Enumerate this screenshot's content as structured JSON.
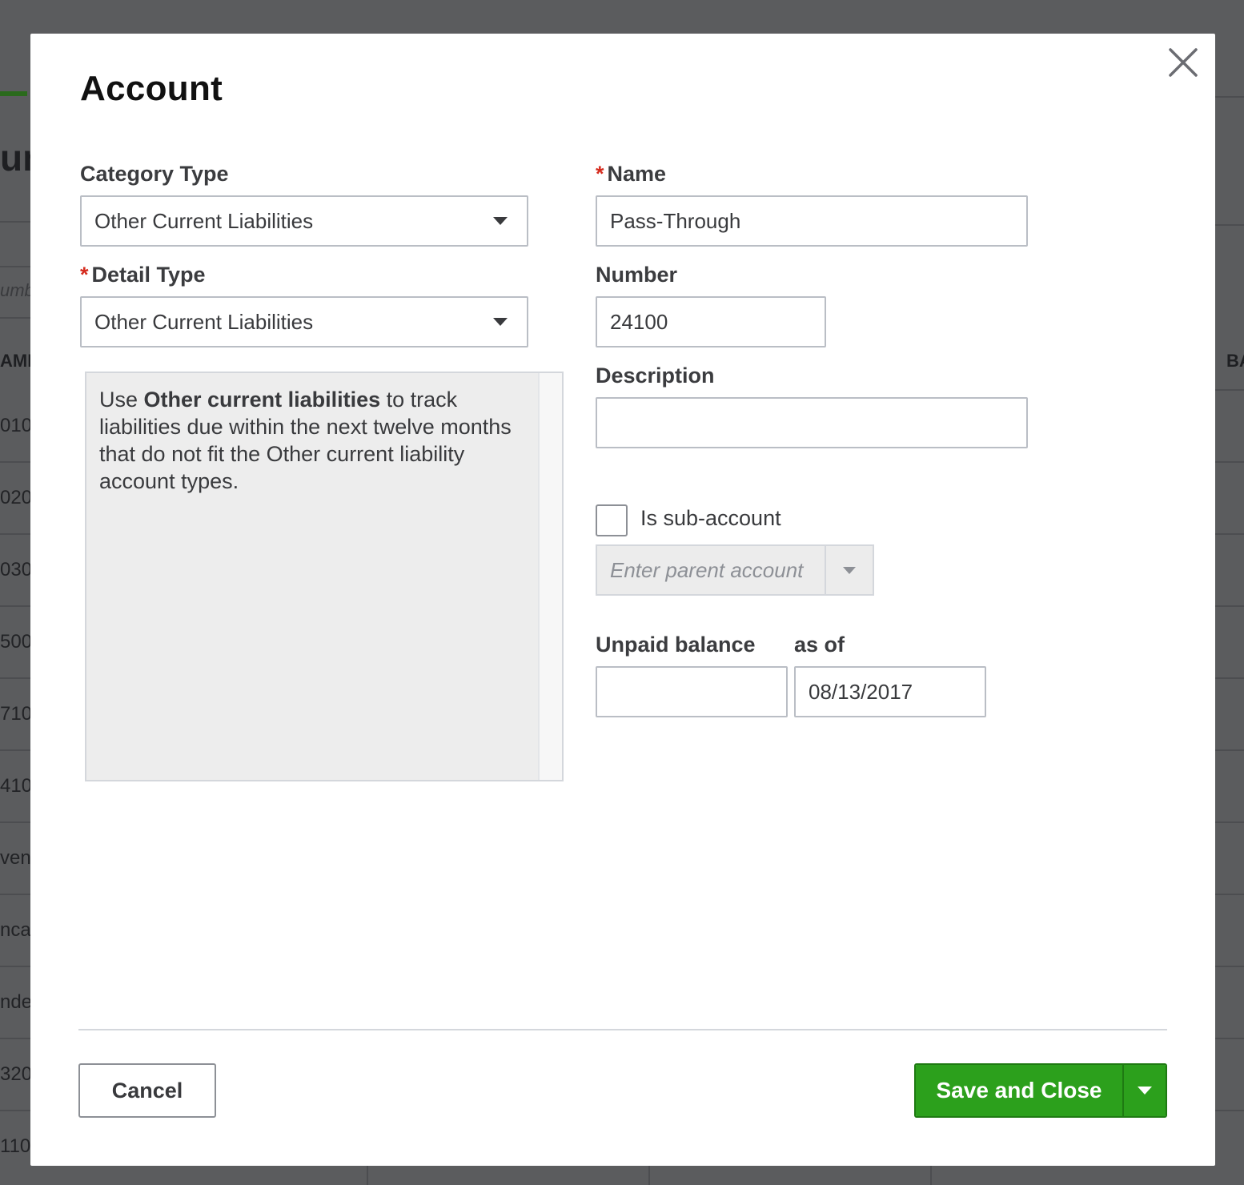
{
  "background": {
    "heading_fragment": "un",
    "search_fragment": "umb",
    "column_left_fragment": "AMI",
    "column_right_fragment": "BA",
    "row_fragments": [
      "010",
      "020",
      "030",
      "500",
      "710",
      "410",
      "ven",
      "ncat",
      "nde",
      "320",
      "110"
    ]
  },
  "modal": {
    "title": "Account",
    "close_icon": "close-icon",
    "category_type": {
      "label": "Category Type",
      "value": "Other Current Liabilities"
    },
    "detail_type": {
      "required_mark": "*",
      "label": "Detail Type",
      "value": "Other Current Liabilities"
    },
    "help": {
      "prefix": "Use ",
      "bold": "Other current liabilities",
      "suffix": " to track liabilities due within the next twelve months that do not fit the Other current liability account types."
    },
    "name": {
      "required_mark": "*",
      "label": "Name",
      "value": "Pass-Through"
    },
    "number": {
      "label": "Number",
      "value": "24100"
    },
    "description": {
      "label": "Description",
      "value": ""
    },
    "sub_account": {
      "label": "Is sub-account",
      "checked": false
    },
    "parent_account": {
      "placeholder": "Enter parent account"
    },
    "unpaid_balance": {
      "label": "Unpaid balance",
      "value": ""
    },
    "as_of": {
      "label": "as of",
      "value": "08/13/2017"
    },
    "buttons": {
      "cancel": "Cancel",
      "save": "Save and Close"
    }
  },
  "colors": {
    "primary_green": "#2ca01c",
    "required_red": "#d52b1e",
    "overlay": "#5b5c5e"
  }
}
